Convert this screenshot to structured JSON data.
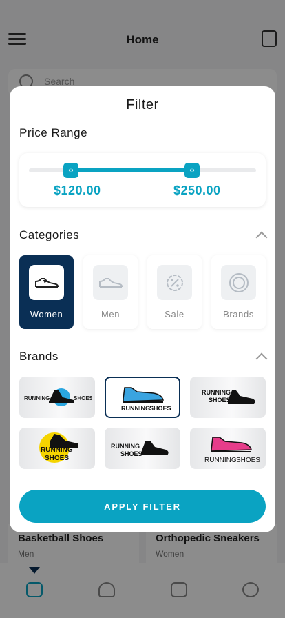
{
  "background": {
    "header_title": "Home",
    "search_placeholder": "Search",
    "cards": [
      {
        "title": "Basketball Shoes",
        "sub": "Men"
      },
      {
        "title": "Orthopedic Sneakers",
        "sub": "Women"
      }
    ]
  },
  "filter": {
    "title": "Filter",
    "price_range": {
      "label": "Price Range",
      "min_value": "$120.00",
      "max_value": "$250.00",
      "min_fraction": 0.24,
      "max_fraction": 0.76
    },
    "categories": {
      "label": "Categories",
      "items": [
        {
          "label": "Women",
          "icon": "sneaker-icon",
          "active": true
        },
        {
          "label": "Men",
          "icon": "sneaker-outline-icon",
          "active": false
        },
        {
          "label": "Sale",
          "icon": "discount-badge-icon",
          "active": false
        },
        {
          "label": "Brands",
          "icon": "ring-icon",
          "active": false
        }
      ]
    },
    "brands": {
      "label": "Brands",
      "logo_text": [
        "RUNNING",
        "SHOES"
      ],
      "items": [
        {
          "logo": "running-shoes-logo-1",
          "selected": false
        },
        {
          "logo": "running-shoes-logo-2",
          "selected": true
        },
        {
          "logo": "running-shoes-logo-3",
          "selected": false
        },
        {
          "logo": "running-shoes-logo-4",
          "selected": false
        },
        {
          "logo": "running-shoes-logo-5",
          "selected": false
        },
        {
          "logo": "running-shoes-logo-6",
          "selected": false
        }
      ]
    },
    "apply_label": "APPLY FILTER"
  },
  "colors": {
    "accent": "#0aa3c2",
    "navy": "#0a2f55"
  }
}
